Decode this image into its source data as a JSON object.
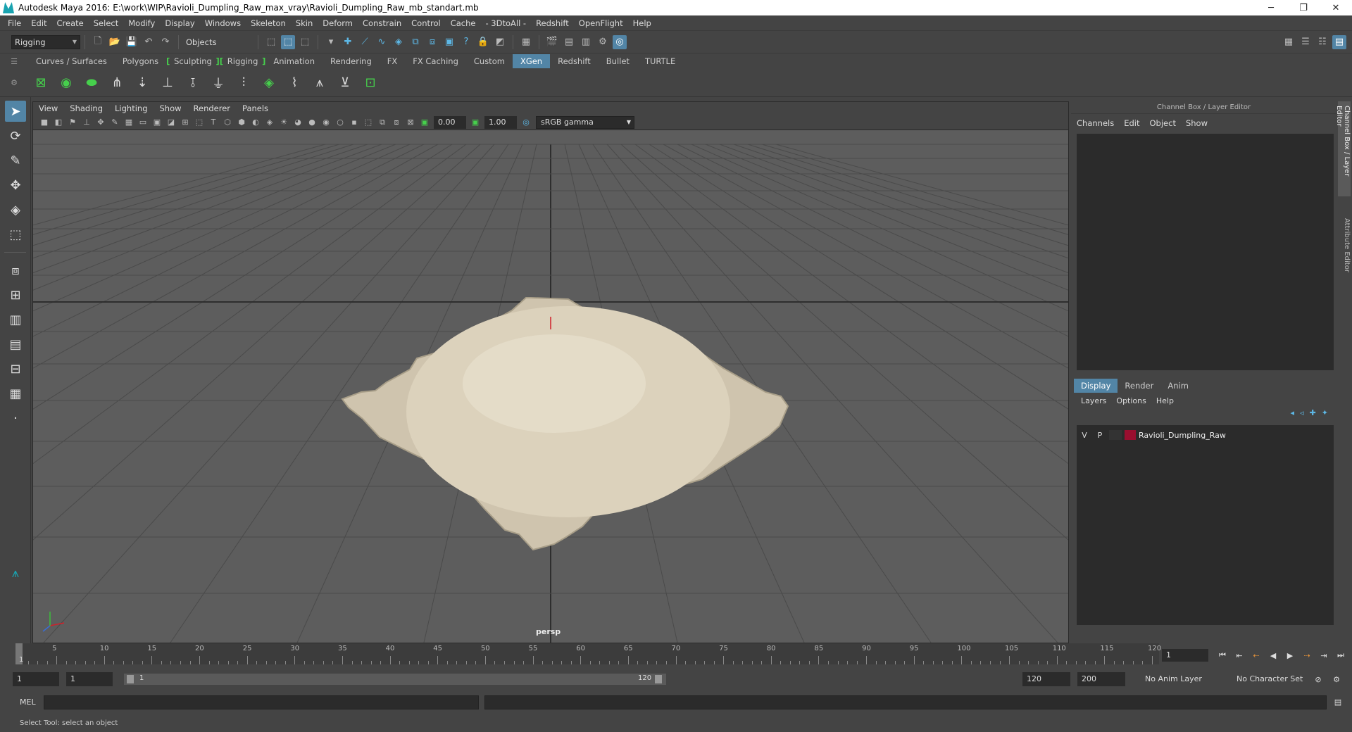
{
  "window": {
    "title": "Autodesk Maya 2016: E:\\work\\WIP\\Ravioli_Dumpling_Raw_max_vray\\Ravioli_Dumpling_Raw_mb_standart.mb",
    "minimize": "─",
    "restore": "❐",
    "close": "✕"
  },
  "menubar": [
    "File",
    "Edit",
    "Create",
    "Select",
    "Modify",
    "Display",
    "Windows",
    "Skeleton",
    "Skin",
    "Deform",
    "Constrain",
    "Control",
    "Cache",
    "- 3DtoAll -",
    "Redshift",
    "OpenFlight",
    "Help"
  ],
  "statusline": {
    "menuset": "Rigging",
    "selection_mode": "Objects"
  },
  "shelf_tabs": [
    {
      "label": "Curves / Surfaces",
      "active": false
    },
    {
      "label": "Polygons",
      "active": false
    },
    {
      "label": "Sculpting",
      "active": false
    },
    {
      "label": "Rigging",
      "active": false
    },
    {
      "label": "Animation",
      "active": false
    },
    {
      "label": "Rendering",
      "active": false
    },
    {
      "label": "FX",
      "active": false
    },
    {
      "label": "FX Caching",
      "active": false
    },
    {
      "label": "Custom",
      "active": false
    },
    {
      "label": "XGen",
      "active": true
    },
    {
      "label": "Redshift",
      "active": false
    },
    {
      "label": "Bullet",
      "active": false
    },
    {
      "label": "TURTLE",
      "active": false
    }
  ],
  "viewport": {
    "menus": [
      "View",
      "Shading",
      "Lighting",
      "Show",
      "Renderer",
      "Panels"
    ],
    "exposure": "0.00",
    "gamma_value": "1.00",
    "color_space": "sRGB gamma",
    "camera": "persp"
  },
  "channel_box": {
    "title": "Channel Box / Layer Editor",
    "menus": [
      "Channels",
      "Edit",
      "Object",
      "Show"
    ],
    "layer_tabs": [
      {
        "label": "Display",
        "active": true
      },
      {
        "label": "Render",
        "active": false
      },
      {
        "label": "Anim",
        "active": false
      }
    ],
    "layer_menus": [
      "Layers",
      "Options",
      "Help"
    ],
    "layers": [
      {
        "v": "V",
        "p": "P",
        "name": "Ravioli_Dumpling_Raw",
        "color": "#9a0e2f"
      }
    ]
  },
  "side_tabs": [
    "Channel Box / Layer Editor",
    "Attribute Editor"
  ],
  "timeslider": {
    "labels": [
      "5",
      "10",
      "15",
      "20",
      "25",
      "30",
      "35",
      "40",
      "45",
      "50",
      "55",
      "60",
      "65",
      "70",
      "75",
      "80",
      "85",
      "90",
      "95",
      "100",
      "105",
      "110",
      "115",
      "120"
    ],
    "first": "1",
    "current_frame": "1"
  },
  "range": {
    "start": "1",
    "playback_start": "1",
    "range_start_label": "1",
    "range_end_label": "120",
    "playback_end": "120",
    "end": "200",
    "anim_layer": "No Anim Layer",
    "character_set": "No Character Set"
  },
  "command": {
    "label": "MEL"
  },
  "help_line": "Select Tool: select an object",
  "colors": {
    "accent": "#5285a6",
    "viewport_bg": "#5d5d5d",
    "layer_color": "#9a0e2f"
  }
}
